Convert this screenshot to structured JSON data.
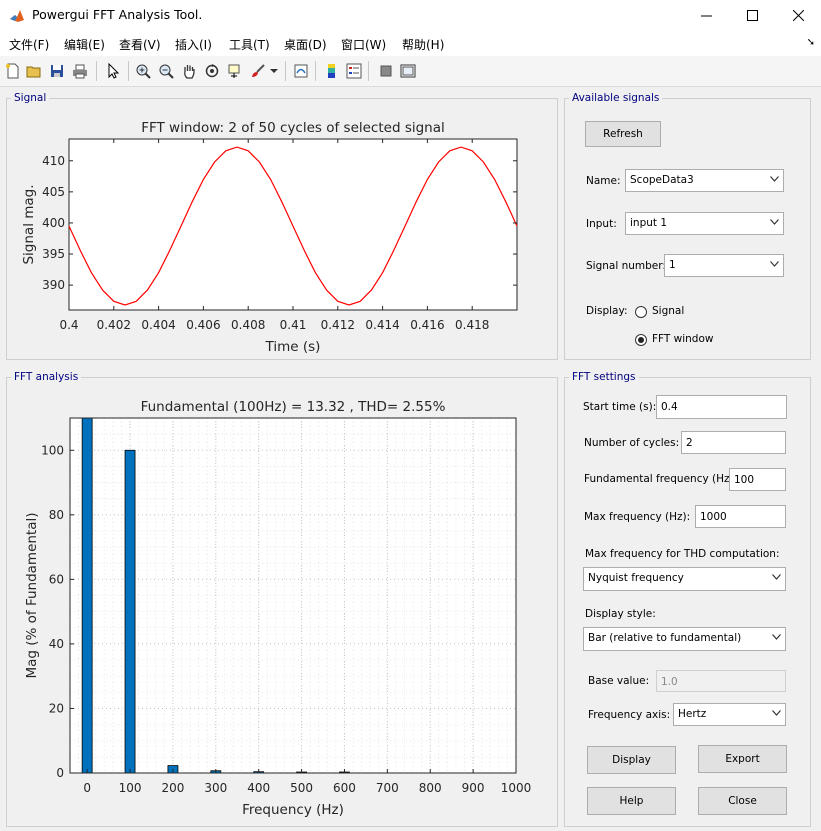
{
  "window": {
    "title": "Powergui FFT Analysis Tool."
  },
  "menu": [
    "文件(F)",
    "编辑(E)",
    "查看(V)",
    "插入(I)",
    "工具(T)",
    "桌面(D)",
    "窗口(W)",
    "帮助(H)"
  ],
  "panels": {
    "signal": "Signal",
    "available": "Available signals",
    "fft_analysis": "FFT analysis",
    "fft_settings": "FFT settings"
  },
  "available": {
    "refresh": "Refresh",
    "name_label": "Name:",
    "name_value": "ScopeData3",
    "input_label": "Input:",
    "input_value": "input 1",
    "signal_number_label": "Signal number:",
    "signal_number_value": "1",
    "display_label": "Display:",
    "radio_signal": "Signal",
    "radio_fft": "FFT window",
    "selected_display": "FFT window"
  },
  "settings": {
    "start_time_label": "Start time (s):",
    "start_time": "0.4",
    "cycles_label": "Number of cycles:",
    "cycles": "2",
    "fund_label": "Fundamental frequency (Hz):",
    "fund": "100",
    "maxfreq_label": "Max frequency (Hz):",
    "maxfreq": "1000",
    "thd_label": "Max frequency for THD computation:",
    "thd_value": "Nyquist frequency",
    "style_label": "Display style:",
    "style_value": "Bar (relative to fundamental)",
    "base_label": "Base value:",
    "base_value": "1.0",
    "axis_label": "Frequency axis:",
    "axis_value": "Hertz"
  },
  "buttons": {
    "display": "Display",
    "export": "Export",
    "help": "Help",
    "close": "Close"
  },
  "colors": {
    "signal_line": "#ff0000",
    "bar_fill": "#0072bd",
    "panel_title": "#00007f"
  },
  "chart_data": [
    {
      "type": "line",
      "title": "FFT window: 2 of 50 cycles of selected signal",
      "xlabel": "Time (s)",
      "ylabel": "Signal mag.",
      "xlim": [
        0.4,
        0.42
      ],
      "ylim": [
        386,
        413.5
      ],
      "xticks": [
        0.4,
        0.402,
        0.404,
        0.406,
        0.408,
        0.41,
        0.412,
        0.414,
        0.416,
        0.418
      ],
      "xtick_labels": [
        "0.4",
        "0.402",
        "0.404",
        "0.406",
        "0.408",
        "0.41",
        "0.412",
        "0.414",
        "0.416",
        "0.418"
      ],
      "yticks": [
        390,
        395,
        400,
        405,
        410
      ],
      "ytick_labels": [
        "390",
        "395",
        "400",
        "405",
        "410"
      ],
      "grid": false,
      "series": [
        {
          "color": "#ff0000",
          "x": [
            0.4,
            0.4005,
            0.401,
            0.4015,
            0.402,
            0.4025,
            0.403,
            0.4035,
            0.404,
            0.4045,
            0.405,
            0.4055,
            0.406,
            0.4065,
            0.407,
            0.4075,
            0.408,
            0.4085,
            0.409,
            0.4095,
            0.41,
            0.4105,
            0.411,
            0.4115,
            0.412,
            0.4125,
            0.413,
            0.4135,
            0.414,
            0.4145,
            0.415,
            0.4155,
            0.416,
            0.4165,
            0.417,
            0.4175,
            0.418,
            0.4185,
            0.419,
            0.4195,
            0.42
          ],
          "y": [
            399.5,
            395.6,
            392.0,
            389.2,
            387.4,
            386.8,
            387.4,
            389.2,
            392.0,
            395.6,
            399.5,
            403.4,
            407.0,
            409.8,
            411.6,
            412.2,
            411.6,
            409.8,
            407.0,
            403.4,
            399.5,
            395.6,
            392.0,
            389.2,
            387.4,
            386.8,
            387.4,
            389.2,
            392.0,
            395.6,
            399.5,
            403.4,
            407.0,
            409.8,
            411.6,
            412.2,
            411.6,
            409.8,
            407.0,
            403.4,
            399.5
          ]
        }
      ]
    },
    {
      "type": "bar",
      "title": "Fundamental (100Hz) = 13.32 , THD= 2.55%",
      "xlabel": "Frequency (Hz)",
      "ylabel": "Mag (% of Fundamental)",
      "xlim": [
        -40,
        1000
      ],
      "ylim": [
        0,
        110
      ],
      "xticks": [
        0,
        100,
        200,
        300,
        400,
        500,
        600,
        700,
        800,
        900,
        1000
      ],
      "xtick_labels": [
        "0",
        "100",
        "200",
        "300",
        "400",
        "500",
        "600",
        "700",
        "800",
        "900",
        "1000"
      ],
      "yticks": [
        0,
        20,
        40,
        60,
        80,
        100
      ],
      "ytick_labels": [
        "0",
        "20",
        "40",
        "60",
        "80",
        "100"
      ],
      "grid": true,
      "bar_color": "#0072bd",
      "x": [
        0,
        100,
        200,
        300,
        400,
        500,
        600
      ],
      "values": [
        110,
        100,
        2.3,
        0.7,
        0.4,
        0.3,
        0.3
      ]
    }
  ]
}
